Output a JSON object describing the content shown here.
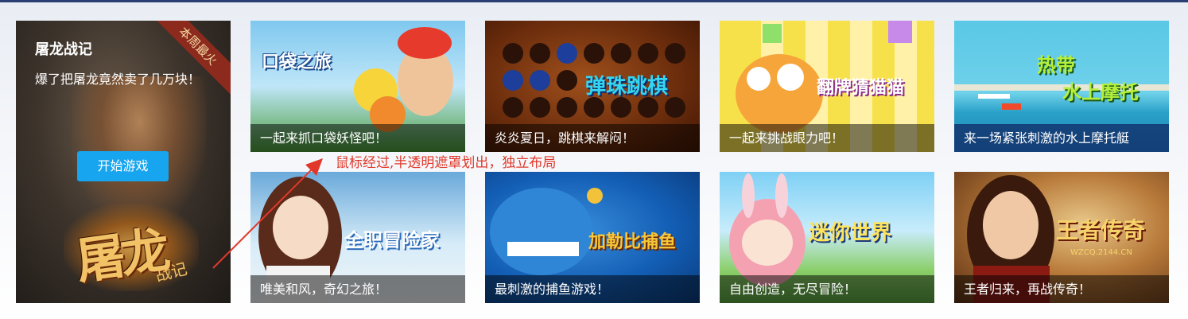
{
  "feature": {
    "title": "屠龙战记",
    "description": "爆了把屠龙竟然卖了几万块！",
    "button_label": "开始游戏",
    "ribbon": "本周最火",
    "logo_text": "屠龙",
    "logo_sub": "战记"
  },
  "cards": [
    {
      "caption": "一起来抓口袋妖怪吧！",
      "logo": "口袋之旅"
    },
    {
      "caption": "炎炎夏日，跳棋来解闷！",
      "logo": "弹珠跳棋"
    },
    {
      "caption": "一起来挑战眼力吧！",
      "logo": "翻牌猜猫猫"
    },
    {
      "caption": "来一场紧张刺激的水上摩托艇",
      "logo_line1": "热带",
      "logo_line2": "水上摩托"
    },
    {
      "caption": "唯美和风，奇幻之旅！",
      "logo": "全职冒险家"
    },
    {
      "caption": "最刺激的捕鱼游戏！",
      "logo": "加勒比捕鱼"
    },
    {
      "caption": "自由创造，无尽冒险！",
      "logo": "迷你世界"
    },
    {
      "caption": "王者归来，再战传奇！",
      "logo": "王者传奇",
      "logo_sub": "WZCQ.2144.CN"
    }
  ],
  "annotation": "鼠标经过,半透明遮罩划出，独立布局",
  "colors": {
    "button": "#17a5ef",
    "annotation": "#e0392b",
    "ribbon": "#8c2a1e"
  }
}
